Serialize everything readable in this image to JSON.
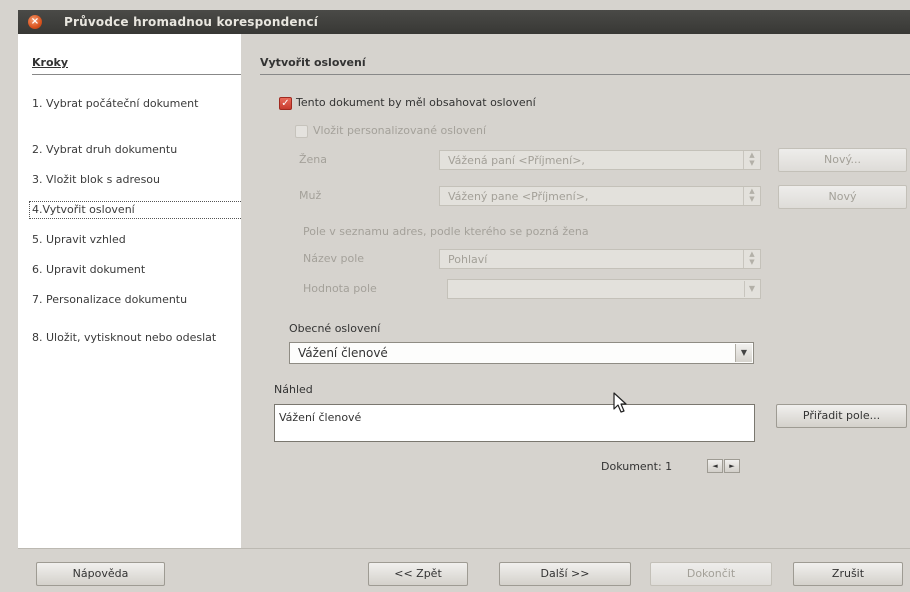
{
  "window": {
    "title": "Průvodce hromadnou korespondencí",
    "close_glyph": "×"
  },
  "steps": {
    "header": "Kroky",
    "items": [
      {
        "label": "1. Vybrat počáteční dokument"
      },
      {
        "label": "2. Vybrat druh dokumentu"
      },
      {
        "label": "3. Vložit blok s adresou"
      },
      {
        "label": "4.Vytvořit oslovení",
        "active": true
      },
      {
        "label": "5. Upravit vzhled"
      },
      {
        "label": "6. Upravit dokument"
      },
      {
        "label": "7. Personalizace dokumentu"
      },
      {
        "label": "8. Uložit, vytisknout nebo odeslat"
      }
    ]
  },
  "salutation": {
    "title": "Vytvořit oslovení",
    "include_checkbox": {
      "label": "Tento dokument by měl obsahovat oslovení",
      "checked": true
    },
    "personalized_checkbox": {
      "label": "Vložit personalizované oslovení",
      "checked": false
    },
    "female": {
      "label": "Žena",
      "value": "Vážená paní <Příjmení>,",
      "new_button": "Nový..."
    },
    "male": {
      "label": "Muž",
      "value": "Vážený pane <Příjmení>,",
      "new_button": "Nový"
    },
    "field_hint": "Pole v seznamu adres, podle kterého se pozná žena",
    "field_name": {
      "label": "Název pole",
      "value": "Pohlaví"
    },
    "field_value": {
      "label": "Hodnota pole",
      "value": ""
    },
    "general": {
      "label": "Obecné oslovení",
      "value": "Vážení členové"
    },
    "preview": {
      "label": "Náhled",
      "text": "Vážení členové",
      "assign_button": "Přiřadit pole..."
    },
    "document_nav": {
      "label": "Dokument: 1",
      "prev": "◄",
      "next": "►"
    }
  },
  "footer": {
    "help": "Nápověda",
    "back": "<< Zpět",
    "next": "Další >>",
    "finish": "Dokončit",
    "cancel": "Zrušit"
  },
  "icons": {
    "spin_up": "▲",
    "spin_down": "▼",
    "dropdown": "▼",
    "check": "✓"
  },
  "colors": {
    "titlebar": "#3f3f3c",
    "accent_checkbox": "#d94a3a",
    "window_bg": "#d6d3ce"
  }
}
